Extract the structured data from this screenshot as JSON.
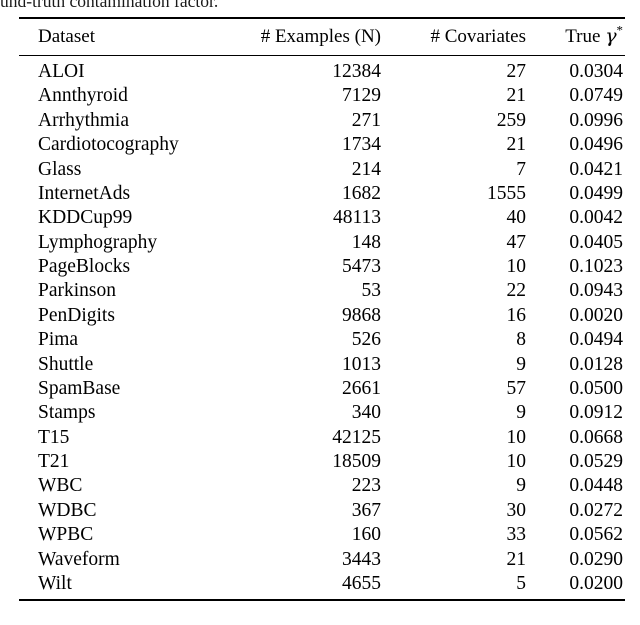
{
  "caption": {
    "clipped_tail": "und-truth contamination factor."
  },
  "table": {
    "columns": [
      {
        "key": "dataset",
        "label": "Dataset",
        "align": "left"
      },
      {
        "key": "n_examples",
        "label": "# Examples (N)",
        "align": "right"
      },
      {
        "key": "n_cov",
        "label": "# Covariates",
        "align": "right"
      },
      {
        "key": "true_gamma",
        "label_prefix": "True ",
        "label_symbol": "γ",
        "label_superscript": "*",
        "align": "right"
      }
    ],
    "rows": [
      {
        "dataset": "ALOI",
        "n_examples": "12384",
        "n_cov": "27",
        "true_gamma": "0.0304"
      },
      {
        "dataset": "Annthyroid",
        "n_examples": "7129",
        "n_cov": "21",
        "true_gamma": "0.0749"
      },
      {
        "dataset": "Arrhythmia",
        "n_examples": "271",
        "n_cov": "259",
        "true_gamma": "0.0996"
      },
      {
        "dataset": "Cardiotocography",
        "n_examples": "1734",
        "n_cov": "21",
        "true_gamma": "0.0496"
      },
      {
        "dataset": "Glass",
        "n_examples": "214",
        "n_cov": "7",
        "true_gamma": "0.0421"
      },
      {
        "dataset": "InternetAds",
        "n_examples": "1682",
        "n_cov": "1555",
        "true_gamma": "0.0499"
      },
      {
        "dataset": "KDDCup99",
        "n_examples": "48113",
        "n_cov": "40",
        "true_gamma": "0.0042"
      },
      {
        "dataset": "Lymphography",
        "n_examples": "148",
        "n_cov": "47",
        "true_gamma": "0.0405"
      },
      {
        "dataset": "PageBlocks",
        "n_examples": "5473",
        "n_cov": "10",
        "true_gamma": "0.1023"
      },
      {
        "dataset": "Parkinson",
        "n_examples": "53",
        "n_cov": "22",
        "true_gamma": "0.0943"
      },
      {
        "dataset": "PenDigits",
        "n_examples": "9868",
        "n_cov": "16",
        "true_gamma": "0.0020"
      },
      {
        "dataset": "Pima",
        "n_examples": "526",
        "n_cov": "8",
        "true_gamma": "0.0494"
      },
      {
        "dataset": "Shuttle",
        "n_examples": "1013",
        "n_cov": "9",
        "true_gamma": "0.0128"
      },
      {
        "dataset": "SpamBase",
        "n_examples": "2661",
        "n_cov": "57",
        "true_gamma": "0.0500"
      },
      {
        "dataset": "Stamps",
        "n_examples": "340",
        "n_cov": "9",
        "true_gamma": "0.0912"
      },
      {
        "dataset": "T15",
        "n_examples": "42125",
        "n_cov": "10",
        "true_gamma": "0.0668"
      },
      {
        "dataset": "T21",
        "n_examples": "18509",
        "n_cov": "10",
        "true_gamma": "0.0529"
      },
      {
        "dataset": "WBC",
        "n_examples": "223",
        "n_cov": "9",
        "true_gamma": "0.0448"
      },
      {
        "dataset": "WDBC",
        "n_examples": "367",
        "n_cov": "30",
        "true_gamma": "0.0272"
      },
      {
        "dataset": "WPBC",
        "n_examples": "160",
        "n_cov": "33",
        "true_gamma": "0.0562"
      },
      {
        "dataset": "Waveform",
        "n_examples": "3443",
        "n_cov": "21",
        "true_gamma": "0.0290"
      },
      {
        "dataset": "Wilt",
        "n_examples": "4655",
        "n_cov": "5",
        "true_gamma": "0.0200"
      }
    ]
  },
  "colors": {
    "page_background": "#ffffff",
    "text": "#000000",
    "rule": "#000000"
  }
}
